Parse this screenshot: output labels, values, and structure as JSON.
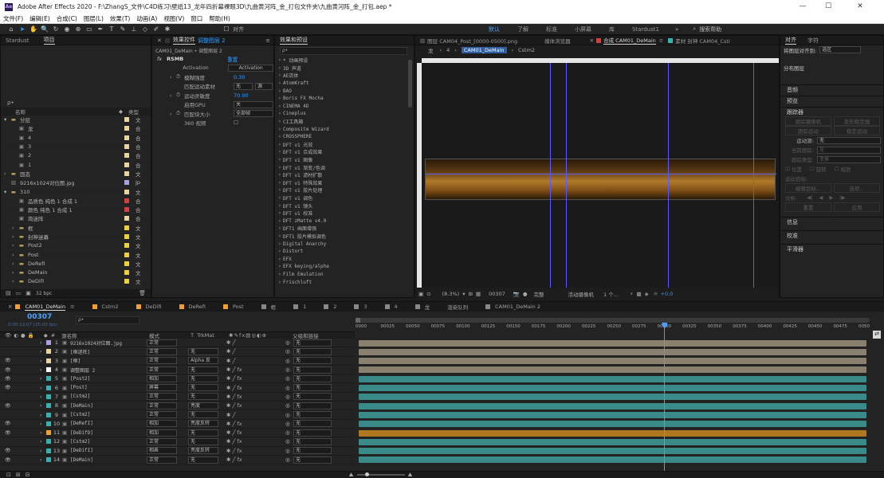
{
  "window": {
    "title": "Adobe After Effects 2020 - F:\\ZhangS_文件\\C4D练习\\壁纸13_龙年四折幕裸眼3D\\九曲黄河阵_金_打包文件夹\\九曲黄河阵_金_打包.aep *",
    "minimize": "—",
    "maximize": "☐",
    "close": "✕"
  },
  "menu": [
    "文件(F)",
    "编辑(E)",
    "合成(C)",
    "图层(L)",
    "效果(T)",
    "动画(A)",
    "视图(V)",
    "窗口",
    "帮助(H)"
  ],
  "toolbar": {
    "align_label": "对齐",
    "workspaces": [
      "默认",
      "了解",
      "标准",
      "小屏幕",
      "库",
      "Stardust1"
    ],
    "active_workspace": "默认",
    "search_placeholder": "搜索帮助"
  },
  "project": {
    "tab_stardust": "Stardust",
    "tab_project": "项目",
    "col_name": "名称",
    "col_type": "类型",
    "bpc": "32 bpc",
    "items": [
      {
        "indent": 0,
        "kind": "folder",
        "name": "分层",
        "color": "#e8d4a0",
        "type": "文"
      },
      {
        "indent": 1,
        "kind": "comp",
        "name": "龙",
        "color": "#e8d4a0",
        "type": "合"
      },
      {
        "indent": 1,
        "kind": "comp",
        "name": "4",
        "color": "#e8d4a0",
        "type": "合"
      },
      {
        "indent": 1,
        "kind": "comp",
        "name": "3",
        "color": "#e8d4a0",
        "type": "合"
      },
      {
        "indent": 1,
        "kind": "comp",
        "name": "2",
        "color": "#e8d4a0",
        "type": "合"
      },
      {
        "indent": 1,
        "kind": "comp",
        "name": "1",
        "color": "#e8d4a0",
        "type": "合"
      },
      {
        "indent": 0,
        "kind": "folder",
        "name": "固态",
        "color": "#e8d4a0",
        "type": "文"
      },
      {
        "indent": 0,
        "kind": "image",
        "name": "9216x1024对位图.jpg",
        "color": "#b0a0e0",
        "type": "Jp"
      },
      {
        "indent": 0,
        "kind": "folder",
        "name": "310",
        "color": "#e8d4a0",
        "type": "文"
      },
      {
        "indent": 1,
        "kind": "comp",
        "name": "品质色 纯色 1 合成 1",
        "color": "#d04040",
        "type": "合"
      },
      {
        "indent": 1,
        "kind": "comp",
        "name": "颜色 纯色 1 合成 1",
        "color": "#d04040",
        "type": "合"
      },
      {
        "indent": 1,
        "kind": "comp",
        "name": "简迷阵",
        "color": "#e8d4a0",
        "type": "合"
      },
      {
        "indent": 1,
        "kind": "folder",
        "name": "框",
        "color": "#e8d040",
        "type": "文"
      },
      {
        "indent": 1,
        "kind": "folder",
        "name": "封神迷幕",
        "color": "#e8d040",
        "type": "文"
      },
      {
        "indent": 1,
        "kind": "folder",
        "name": "Post2",
        "color": "#e8d040",
        "type": "文"
      },
      {
        "indent": 1,
        "kind": "folder",
        "name": "Post",
        "color": "#e8d040",
        "type": "文"
      },
      {
        "indent": 1,
        "kind": "folder",
        "name": "DeRefI",
        "color": "#e8d040",
        "type": "文"
      },
      {
        "indent": 1,
        "kind": "folder",
        "name": "DeMain",
        "color": "#e8d040",
        "type": "文"
      },
      {
        "indent": 1,
        "kind": "folder",
        "name": "DeDifI",
        "color": "#e8d040",
        "type": "文"
      }
    ]
  },
  "effect_controls": {
    "tab": "效果控件",
    "tab_layer": "调整图层 2",
    "header": "CAM01_DeMain • 调整图层 2",
    "effect_name": "RSMB",
    "reset": "重置",
    "rows": [
      {
        "label": "Activation",
        "value": "Activation",
        "kind": "button"
      },
      {
        "label": "模糊强度",
        "value": "0.30",
        "kind": "value",
        "stopwatch": true
      },
      {
        "label": "匹配运动素材",
        "value": "无",
        "kind": "drop2",
        "value2": "源"
      },
      {
        "label": "运动灵敏度",
        "value": "70.00",
        "kind": "value",
        "stopwatch": true
      },
      {
        "label": "启用GPU",
        "value": "关",
        "kind": "drop"
      },
      {
        "label": "匹配块大小",
        "value": "全部帧",
        "kind": "drop",
        "stopwatch": true
      },
      {
        "label": "360 视频",
        "value": "",
        "kind": "check"
      }
    ]
  },
  "effects_presets": {
    "tab": "效果和预设",
    "search_placeholder": "ρ•",
    "items": [
      "* 动画预设",
      "3D 声道",
      "AE流体",
      "AtomKraft",
      "BAO",
      "Boris FX Mocha",
      "CINEMA 4D",
      "Cineplus",
      "CI工具箱",
      "Composite Wizard",
      "CROSSPHERE",
      "DFT v1 光效",
      "DFT v1 合成效果",
      "DFT v1 图像",
      "DFT v1 渐变/色调",
      "DFT v1 滤材扩散",
      "DFT v1 特殊效果",
      "DFT v1 胶片处理",
      "DFT v1 调色",
      "DFT v1 镜头",
      "DFT v1 校准",
      "DFT zMatte v4.0",
      "DFT1 画面增强",
      "DFT1 胶片模拟调色",
      "Digital Anarchy",
      "Distort",
      "EFX",
      "EFX keying/alpha",
      "Film Emulation",
      "Frischluft"
    ]
  },
  "viewer": {
    "tab_layer": "图层 CAM04_Post_[0000-0500].png",
    "tab_media": "媒体浏览器",
    "tab_comp": "合成 CAM01_DeMain",
    "tab_footage": "素材 封神 CAM04_Csti",
    "nav_dragon": "龙",
    "nav_4": "4",
    "nav_comp": "CAM01_DeMain",
    "nav_cstm": "Cstm2",
    "zoom": "(8.3%)",
    "frame": "00307",
    "quality": "完整",
    "camera": "活动摄像机",
    "views": "1 个...",
    "exposure": "+0.0"
  },
  "right_panel": {
    "tab_align": "对齐",
    "tab_char": "字符",
    "align_to_label": "将图层对齐到:",
    "align_to_value": "选区",
    "distribute": "分布图层",
    "audio": "音频",
    "preview": "预览",
    "tracker": "跟踪器",
    "btn_track_camera": "跟踪摄像机",
    "btn_warp": "变形稳定器",
    "btn_track_motion": "跟踪运动",
    "btn_stabilize": "稳定运动",
    "motion_source_label": "运动源:",
    "motion_source_value": "无",
    "current_track_label": "当前跟踪:",
    "current_track_value": "无",
    "track_type_label": "跟踪类型:",
    "track_type_value": "变换",
    "check_position": "位置",
    "check_rotation": "旋转",
    "check_scale": "缩放",
    "edit_target": "编辑目标...",
    "options": "选项...",
    "analyze": "分析:",
    "reset": "重置",
    "apply": "应用",
    "info": "信息",
    "proofing": "校准",
    "smoother": "平滑器"
  },
  "timeline": {
    "tabs": [
      {
        "name": "CAM01_DeMain",
        "color": "#f0a030",
        "active": true
      },
      {
        "name": "Cstm2",
        "color": "#f0a030"
      },
      {
        "name": "DeDifI",
        "color": "#f0a030"
      },
      {
        "name": "DeRefI",
        "color": "#f0a030"
      },
      {
        "name": "Post",
        "color": "#f0a030"
      },
      {
        "name": "框",
        "color": "#888888"
      },
      {
        "name": "1",
        "color": "#888888"
      },
      {
        "name": "2",
        "color": "#888888"
      },
      {
        "name": "3",
        "color": "#888888"
      },
      {
        "name": "4",
        "color": "#888888"
      },
      {
        "name": "龙",
        "color": "#888888"
      },
      {
        "name": "渲染队列",
        "color": ""
      },
      {
        "name": "CAM01_DeMain 2",
        "color": "#888888"
      }
    ],
    "timecode": "00307",
    "timecode_sub": "0:00:12:07 (25.00 fps)",
    "col_source": "源名称",
    "col_mode": "模式",
    "col_trkmat": "TrkMat",
    "col_parent": "父级和链接",
    "ruler": [
      "0000",
      "00025",
      "00050",
      "00075",
      "00100",
      "00125",
      "00150",
      "00175",
      "00200",
      "00225",
      "00250",
      "00275",
      "00300",
      "00325",
      "00350",
      "00375",
      "00400",
      "00425",
      "00450",
      "00475",
      "0050"
    ],
    "current_frame": 307,
    "total_frames": 500,
    "layers": [
      {
        "num": "1",
        "color": "#b0a0e0",
        "name": "9216x1024对位图.jpg",
        "mode": "正常",
        "trk": "",
        "parent": "无",
        "fx": false,
        "bar": "#8a8070",
        "eye": false
      },
      {
        "num": "2",
        "color": "#e8d4a0",
        "name": "[框迷阵]",
        "mode": "正常",
        "trk": "无",
        "parent": "无",
        "fx": false,
        "bar": "#8a8070",
        "eye": false
      },
      {
        "num": "3",
        "color": "#e8d4a0",
        "name": "[框]",
        "mode": "正常",
        "trk": "Alpha 反",
        "parent": "无",
        "fx": false,
        "bar": "#8a8070",
        "eye": true
      },
      {
        "num": "4",
        "color": "#ffffff",
        "name": "调整图层 2",
        "mode": "正常",
        "trk": "无",
        "parent": "无",
        "fx": true,
        "bar": "#8a8070",
        "eye": true
      },
      {
        "num": "5",
        "color": "#3ab0b0",
        "name": "[Post2]",
        "mode": "相加",
        "trk": "无",
        "parent": "无",
        "fx": true,
        "bar": "#3a8a8a",
        "eye": true
      },
      {
        "num": "6",
        "color": "#3ab0b0",
        "name": "[Post]",
        "mode": "屏幕",
        "trk": "无",
        "parent": "无",
        "fx": true,
        "bar": "#3a8a8a",
        "eye": true
      },
      {
        "num": "7",
        "color": "#3ab0b0",
        "name": "[Cstm2]",
        "mode": "正常",
        "trk": "无",
        "parent": "无",
        "fx": true,
        "bar": "#3a8a8a",
        "eye": false
      },
      {
        "num": "8",
        "color": "#3ab0b0",
        "name": "[DeMain]",
        "mode": "正常",
        "trk": "亮度",
        "parent": "无",
        "fx": true,
        "bar": "#3a8a8a",
        "eye": true
      },
      {
        "num": "9",
        "color": "#3ab0b0",
        "name": "[Cstm2]",
        "mode": "正常",
        "trk": "无",
        "parent": "无",
        "fx": false,
        "bar": "#3a8a8a",
        "eye": false
      },
      {
        "num": "10",
        "color": "#3ab0b0",
        "name": "[DeRefI]",
        "mode": "相加",
        "trk": "亮度反转",
        "parent": "无",
        "fx": true,
        "bar": "#3a8a8a",
        "eye": true
      },
      {
        "num": "11",
        "color": "#f0a030",
        "name": "[DeDifD]",
        "mode": "相加",
        "trk": "无",
        "parent": "无",
        "fx": true,
        "bar": "#b07820",
        "eye": true
      },
      {
        "num": "12",
        "color": "#3ab0b0",
        "name": "[Cstm2]",
        "mode": "正常",
        "trk": "无",
        "parent": "无",
        "fx": true,
        "bar": "#3a8a8a",
        "eye": false
      },
      {
        "num": "13",
        "color": "#3ab0b0",
        "name": "[DeDifI]",
        "mode": "相乘",
        "trk": "亮度反转",
        "parent": "无",
        "fx": true,
        "bar": "#3a8a8a",
        "eye": true
      },
      {
        "num": "14",
        "color": "#3ab0b0",
        "name": "[DeMain]",
        "mode": "正常",
        "trk": "无",
        "parent": "无",
        "fx": true,
        "bar": "#3a8a8a",
        "eye": true
      }
    ]
  },
  "colors": {
    "accent": "#2f9cff",
    "playhead": "#4a9cff"
  }
}
